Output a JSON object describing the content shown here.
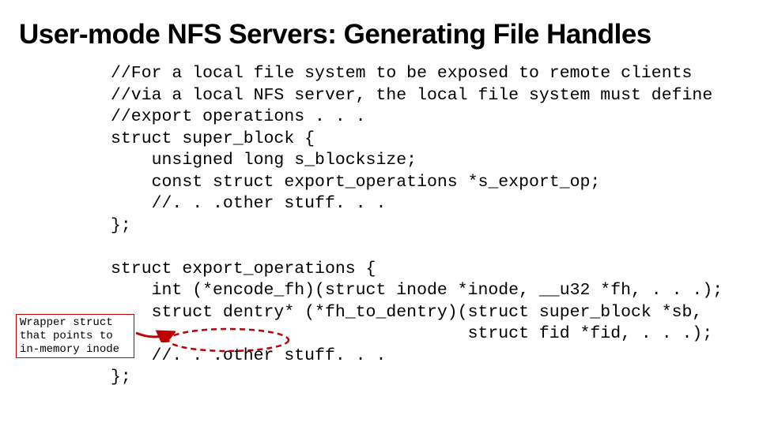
{
  "title": "User-mode NFS Servers: Generating File Handles",
  "code": {
    "l1": "//For a local file system to be exposed to remote clients",
    "l2": "//via a local NFS server, the local file system must define",
    "l3": "//export operations . . .",
    "l4": "struct super_block {",
    "l5": "    unsigned long s_blocksize;",
    "l6": "    const struct export_operations *s_export_op;",
    "l7": "    //. . .other stuff. . .",
    "l8": "};",
    "l9": "",
    "l10": "struct export_operations {",
    "l11": "    int (*encode_fh)(struct inode *inode, __u32 *fh, . . .);",
    "l12": "    struct dentry* (*fh_to_dentry)(struct super_block *sb,",
    "l13": "                                   struct fid *fid, . . .);",
    "l14": "    //. . .other stuff. . .",
    "l15": "};"
  },
  "callout": {
    "l1": "Wrapper struct",
    "l2": "that points to",
    "l3": "in-memory inode"
  },
  "colors": {
    "accent": "#c00000"
  }
}
